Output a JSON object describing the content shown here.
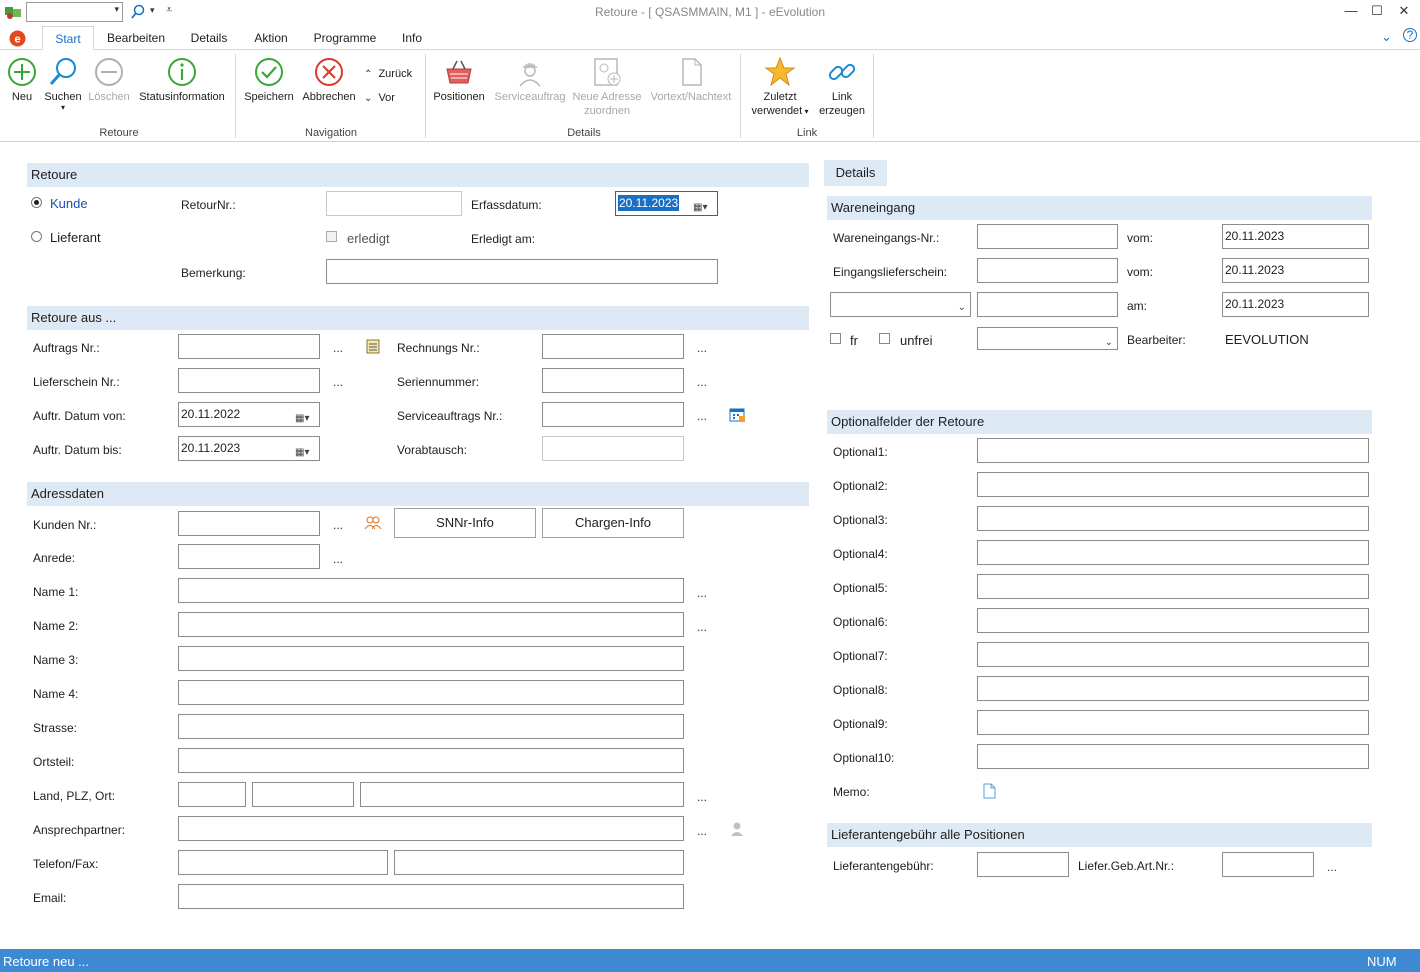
{
  "window": {
    "title": "Retoure - [ QSASMMAIN, M1 ]  -  eEvolution"
  },
  "ribbon_tabs": [
    "Start",
    "Bearbeiten",
    "Details",
    "Aktion",
    "Programme",
    "Info"
  ],
  "ribbon": {
    "neu": "Neu",
    "suchen": "Suchen",
    "loeschen": "Löschen",
    "statusinfo": "Statusinformation",
    "speichern": "Speichern",
    "abbrechen": "Abbrechen",
    "zurueck": "Zurück",
    "vor": "Vor",
    "positionen": "Positionen",
    "serviceauftrag": "Serviceauftrag",
    "neue_adresse_1": "Neue Adresse",
    "neue_adresse_2": "zuordnen",
    "vortext": "Vortext/Nachtext",
    "zuletzt_1": "Zuletzt",
    "zuletzt_2": "verwendet",
    "link_1": "Link",
    "link_2": "erzeugen",
    "group_retoure": "Retoure",
    "group_navigation": "Navigation",
    "group_details": "Details",
    "group_link": "Link"
  },
  "retoure": {
    "section": "Retoure",
    "kunde": "Kunde",
    "lieferant": "Lieferant",
    "retournr_label": "RetourNr.:",
    "retournr_value": "",
    "erledigt": "erledigt",
    "erfassdatum_label": "Erfassdatum:",
    "erfassdatum_value": "20.11.2023",
    "erledigt_am_label": "Erledigt am:",
    "bemerkung_label": "Bemerkung:",
    "bemerkung_value": ""
  },
  "retoure_aus": {
    "section": "Retoure aus ...",
    "auftrags_nr": "Auftrags Nr.:",
    "lieferschein_nr": "Lieferschein Nr.:",
    "auftr_datum_von": "Auftr. Datum von:",
    "auftr_datum_von_value": "20.11.2022",
    "auftr_datum_bis": "Auftr. Datum bis:",
    "auftr_datum_bis_value": "20.11.2023",
    "rechnungs_nr": "Rechnungs Nr.:",
    "seriennummer": "Seriennummer:",
    "serviceauftrags_nr": "Serviceauftrags Nr.:",
    "vorabtausch": "Vorabtausch:"
  },
  "adressdaten": {
    "section": "Adressdaten",
    "kunden_nr": "Kunden Nr.:",
    "snnr_button": "SNNr-Info",
    "chargen_button": "Chargen-Info",
    "anrede": "Anrede:",
    "name1": "Name 1:",
    "name2": "Name 2:",
    "name3": "Name 3:",
    "name4": "Name 4:",
    "strasse": "Strasse:",
    "ortsteil": "Ortsteil:",
    "land_plz_ort": "Land, PLZ, Ort:",
    "ansprechpartner": "Ansprechpartner:",
    "telefon_fax": "Telefon/Fax:",
    "email": "Email:"
  },
  "details": {
    "tab": "Details",
    "wareneingang_section": "Wareneingang",
    "wareneingangs_nr": "Wareneingangs-Nr.:",
    "vom1": "vom:",
    "vom1_value": "20.11.2023",
    "eingangslieferschein": "Eingangslieferschein:",
    "vom2": "vom:",
    "vom2_value": "20.11.2023",
    "am": "am:",
    "am_value": "20.11.2023",
    "fr": "fr",
    "unfrei": "unfrei",
    "bearbeiter": "Bearbeiter:",
    "bearbeiter_value": "EEVOLUTION",
    "optional_section": "Optionalfelder der Retoure",
    "optional_labels": [
      "Optional1:",
      "Optional2:",
      "Optional3:",
      "Optional4:",
      "Optional5:",
      "Optional6:",
      "Optional7:",
      "Optional8:",
      "Optional9:",
      "Optional10:"
    ],
    "memo": "Memo:",
    "lieferantengebuehr_section": "Lieferantengebühr alle Positionen",
    "lieferantengebuehr": "Lieferantengebühr:",
    "liefer_geb_art_nr": "Liefer.Geb.Art.Nr.:"
  },
  "dots": "...",
  "status": {
    "left": "Retoure neu ...",
    "right": "NUM"
  },
  "colors": {
    "accent": "#1a6fc4",
    "section_bg": "#dde9f5",
    "status_bg": "#3d8ad3"
  }
}
